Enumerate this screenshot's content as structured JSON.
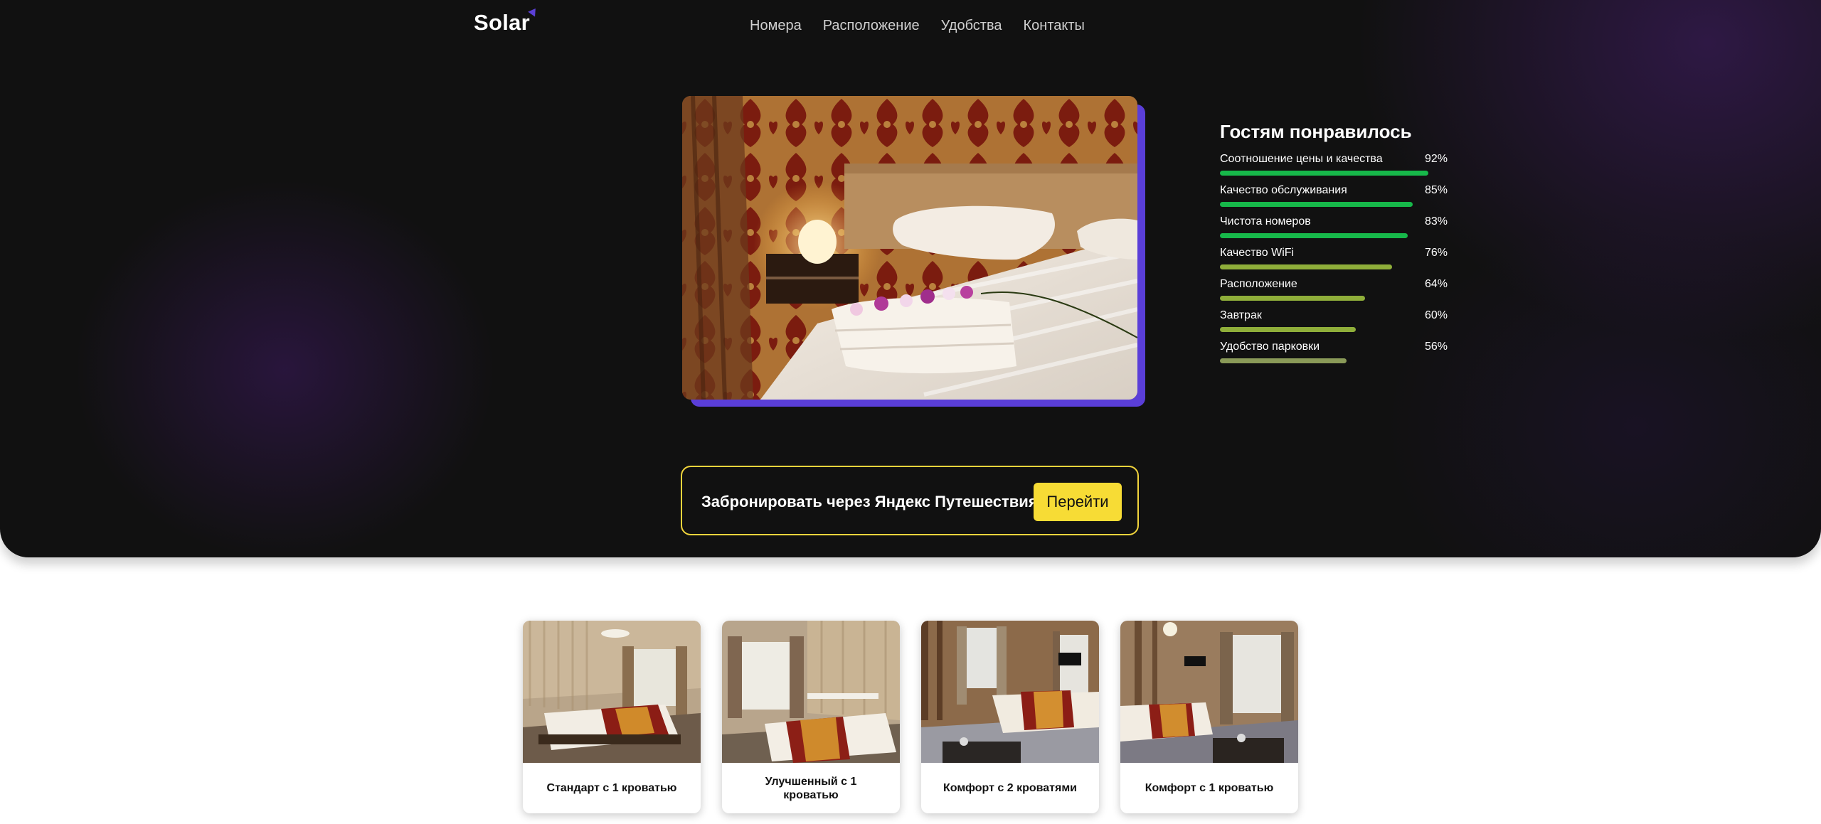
{
  "header": {
    "logo_text": "Solar",
    "nav": [
      "Номера",
      "Расположение",
      "Удобства",
      "Контакты"
    ]
  },
  "ratings": {
    "title": "Гостям понравилось",
    "items": [
      {
        "label": "Соотношение цены и качества",
        "percent_text": "92%",
        "value": 92,
        "color": "#17b84a"
      },
      {
        "label": "Качество обслуживания",
        "percent_text": "85%",
        "value": 85,
        "color": "#17b84a"
      },
      {
        "label": "Чистота номеров",
        "percent_text": "83%",
        "value": 83,
        "color": "#17b84a"
      },
      {
        "label": "Качество WiFi",
        "percent_text": "76%",
        "value": 76,
        "color": "#8fae3a"
      },
      {
        "label": "Расположение",
        "percent_text": "64%",
        "value": 64,
        "color": "#8fae3a"
      },
      {
        "label": "Завтрак",
        "percent_text": "60%",
        "value": 60,
        "color": "#8fae3a"
      },
      {
        "label": "Удобство парковки",
        "percent_text": "56%",
        "value": 56,
        "color": "#8a9a58"
      }
    ]
  },
  "booking": {
    "text": "Забронировать через Яндекс Путешествия",
    "button_label": "Перейти"
  },
  "rooms": [
    {
      "title": "Стандарт с 1 кроватью"
    },
    {
      "title": "Улучшенный с 1 кроватью"
    },
    {
      "title": "Комфорт с 2 кроватями"
    },
    {
      "title": "Комфорт с 1 кроватью"
    }
  ],
  "colors": {
    "accent_purple": "#5a3ed8",
    "accent_yellow": "#f7dc35",
    "dark_background": "#111111"
  }
}
